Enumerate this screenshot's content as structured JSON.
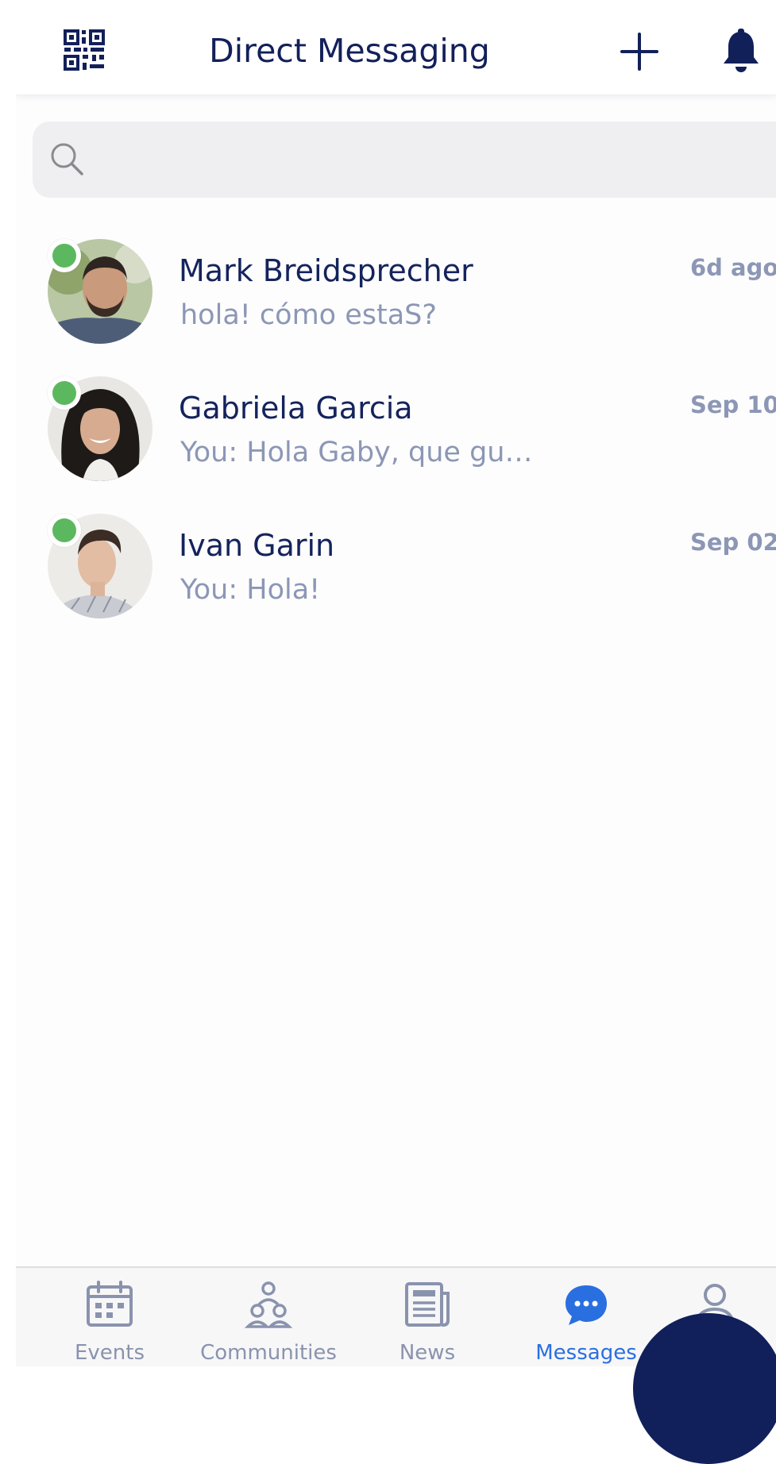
{
  "header": {
    "title": "Direct Messaging",
    "icons": {
      "left": "qr-code-icon",
      "add": "plus-icon",
      "notifications": "bell-icon"
    }
  },
  "search": {
    "placeholder": "",
    "value": "",
    "icon": "search-icon"
  },
  "conversations": [
    {
      "name": "Mark Breidsprecher",
      "preview": "hola! cómo estaS?",
      "time": "6d ago",
      "online": true
    },
    {
      "name": "Gabriela Garcia",
      "preview": "You: Hola Gaby, que gu…",
      "time": "Sep 10",
      "online": true
    },
    {
      "name": "Ivan Garin",
      "preview": "You: Hola!",
      "time": "Sep 02",
      "online": true
    }
  ],
  "nav": {
    "items": [
      {
        "label": "Events",
        "icon": "calendar-icon",
        "active": false
      },
      {
        "label": "Communities",
        "icon": "people-icon",
        "active": false
      },
      {
        "label": "News",
        "icon": "newspaper-icon",
        "active": false
      },
      {
        "label": "Messages",
        "icon": "chat-bubble-icon",
        "active": true
      },
      {
        "label": "",
        "icon": "profile-icon",
        "active": false
      }
    ]
  },
  "colors": {
    "primary": "#12205a",
    "accent": "#2a6fe0",
    "online": "#5cb85f",
    "muted": "#8c97b6"
  }
}
